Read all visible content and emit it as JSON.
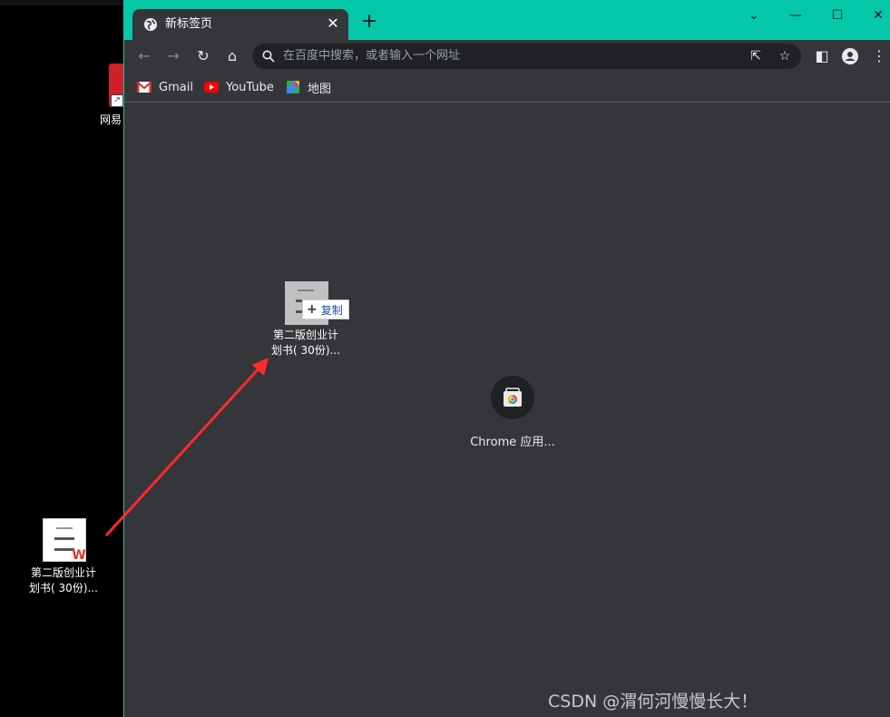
{
  "desktop": {
    "top_icon_label": "网易",
    "file_label_line1": "第二版创业计",
    "file_label_line2": "划书( 30份)..."
  },
  "browser": {
    "tab": {
      "title": "新标签页"
    },
    "omnibox": {
      "placeholder": "在百度中搜索，或者输入一个网址"
    },
    "bookmarks": [
      {
        "label": "Gmail",
        "icon": "gmail-icon"
      },
      {
        "label": "YouTube",
        "icon": "youtube-icon"
      },
      {
        "label": "地图",
        "icon": "maps-icon"
      }
    ],
    "drag": {
      "copy_label": "复制",
      "label_line1": "第二版创业计",
      "label_line2": "划书( 30份)..."
    },
    "shortcut": {
      "label": "Chrome 应用..."
    }
  },
  "watermark": "CSDN @渭何河慢慢长大！",
  "colors": {
    "titlebar": "#04c8a8",
    "content_bg": "#35363a",
    "arrow": "#ff2a2a"
  }
}
